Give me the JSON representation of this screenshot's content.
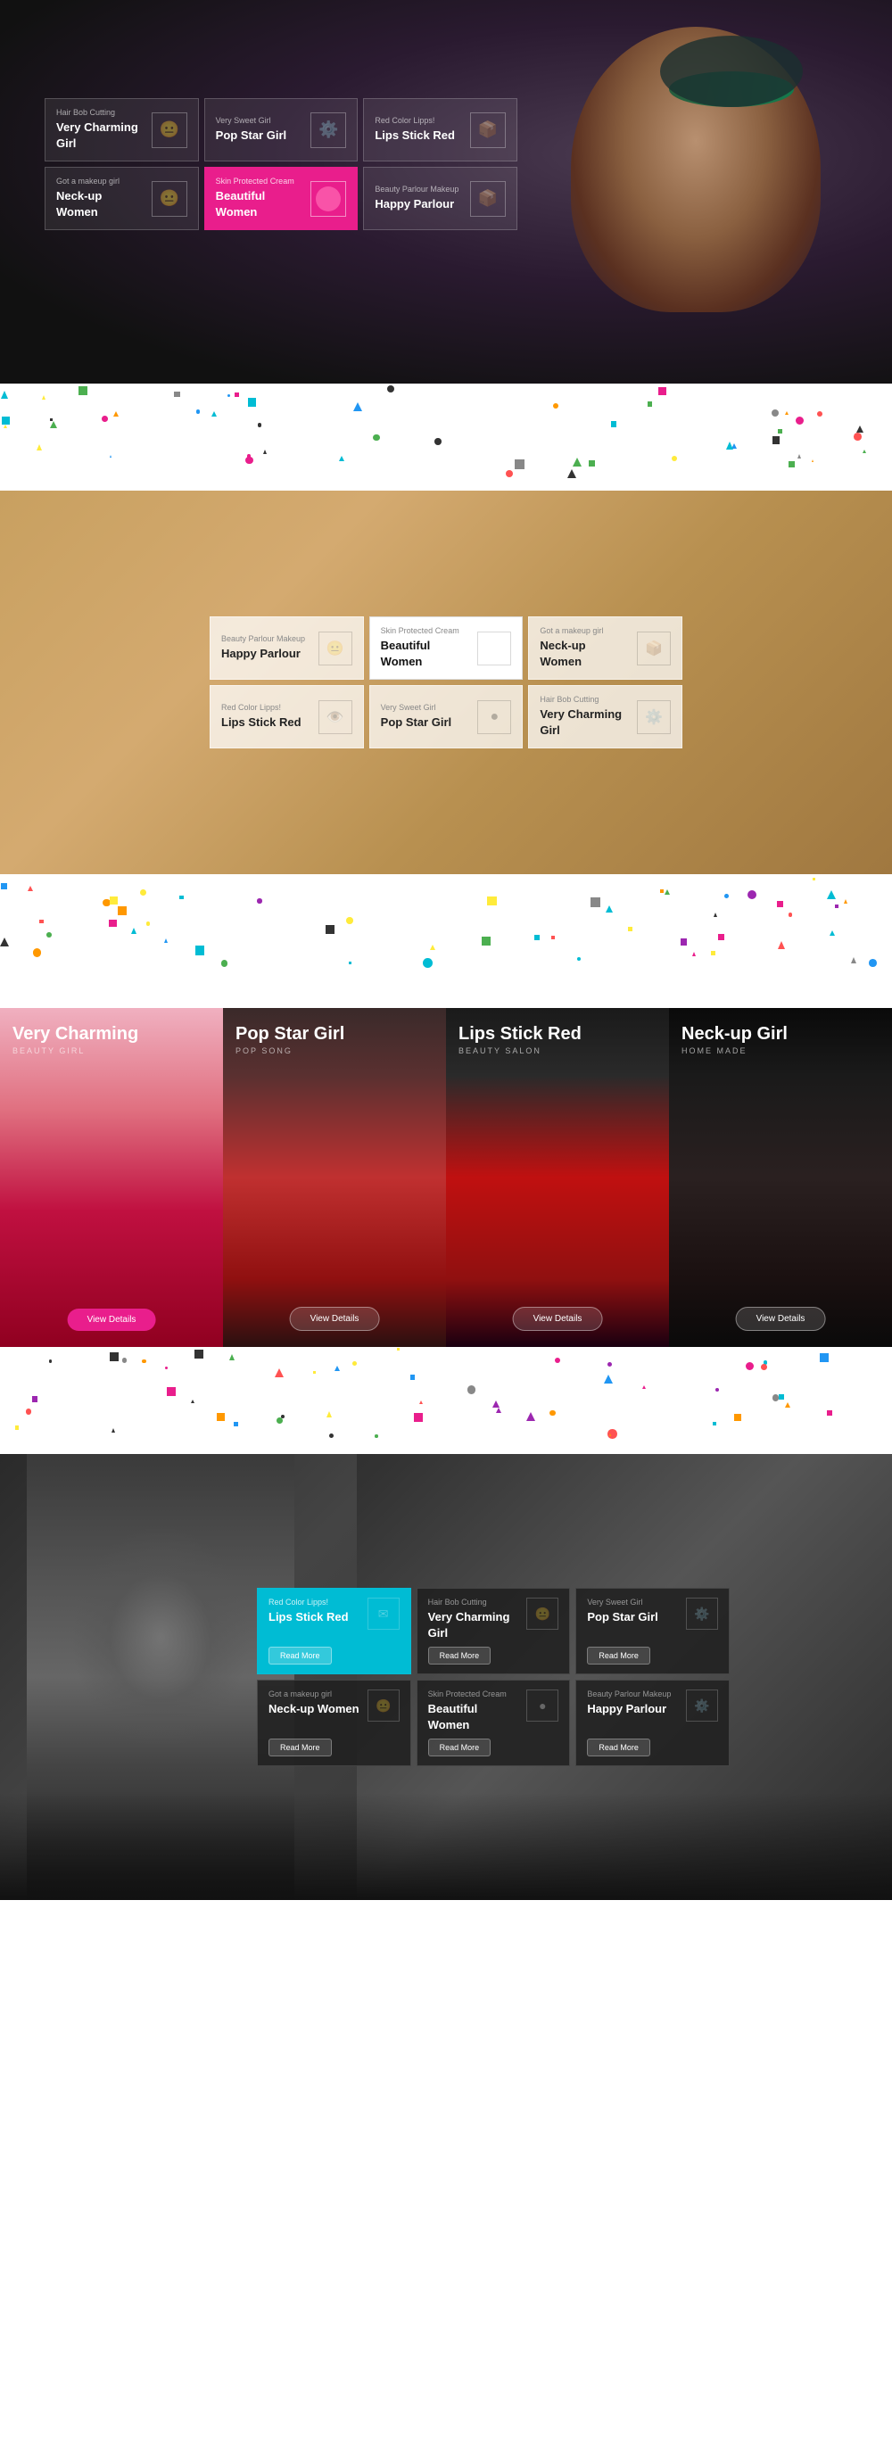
{
  "hero": {
    "cards": [
      {
        "subtitle": "Hair Bob Cutting",
        "title": "Very Charming Girl",
        "icon": "😐"
      },
      {
        "subtitle": "Very Sweet Girl",
        "title": "Pop Star Girl",
        "icon": "⚙️"
      },
      {
        "subtitle": "Red Color Lipps!",
        "title": "Lips Stick Red",
        "icon": "📦"
      },
      {
        "subtitle": "Got a makeup girl",
        "title": "Neck-up Women",
        "icon": "😐"
      },
      {
        "subtitle": "Skin Protected Cream",
        "title": "Beautiful Women",
        "icon": "●",
        "active": true
      },
      {
        "subtitle": "Beauty Parlour Makeup",
        "title": "Happy Parlour",
        "icon": "📦"
      }
    ]
  },
  "section2": {
    "cards": [
      {
        "subtitle": "Beauty Parlour Makeup",
        "title": "Happy Parlour",
        "icon": "😐"
      },
      {
        "subtitle": "Skin Protected Cream",
        "title": "Beautiful Women",
        "icon": "",
        "active": true
      },
      {
        "subtitle": "Got a makeup girl",
        "title": "Neck-up Women",
        "icon": "📦"
      },
      {
        "subtitle": "Red Color Lipps!",
        "title": "Lips Stick Red",
        "icon": "👁️"
      },
      {
        "subtitle": "Very Sweet Girl",
        "title": "Pop Star Girl",
        "icon": "●"
      },
      {
        "subtitle": "Hair Bob Cutting",
        "title": "Very Charming Girl",
        "icon": "⚙️"
      }
    ]
  },
  "imgCards": [
    {
      "title": "Very Charming",
      "sub": "BEAUTY GIRL",
      "btn": "View Details"
    },
    {
      "title": "Pop Star Girl",
      "sub": "POP SONG",
      "btn": "View Details"
    },
    {
      "title": "Lips Stick Red",
      "sub": "BEAUTY SALON",
      "btn": "View Details"
    },
    {
      "title": "Neck-up Girl",
      "sub": "HOME MADE",
      "btn": "View Details"
    }
  ],
  "section4": {
    "cards": [
      {
        "subtitle": "Red Color Lipps!",
        "title": "Lips Stick Red",
        "icon": "✉",
        "btn": "Read More",
        "cyan": true
      },
      {
        "subtitle": "Hair Bob Cutting",
        "title": "Very Charming Girl",
        "icon": "😐",
        "btn": "Read More"
      },
      {
        "subtitle": "Very Sweet Girl",
        "title": "Pop Star Girl",
        "icon": "⚙️",
        "btn": "Read More"
      },
      {
        "subtitle": "Got a makeup girl",
        "title": "Neck-up Women",
        "icon": "😐",
        "btn": "Read More"
      },
      {
        "subtitle": "Skin Protected Cream",
        "title": "Beautiful Women",
        "icon": "●",
        "btn": "Read More"
      },
      {
        "subtitle": "Beauty Parlour Makeup",
        "title": "Happy Parlour",
        "icon": "⚙️",
        "btn": "Read More"
      }
    ]
  }
}
